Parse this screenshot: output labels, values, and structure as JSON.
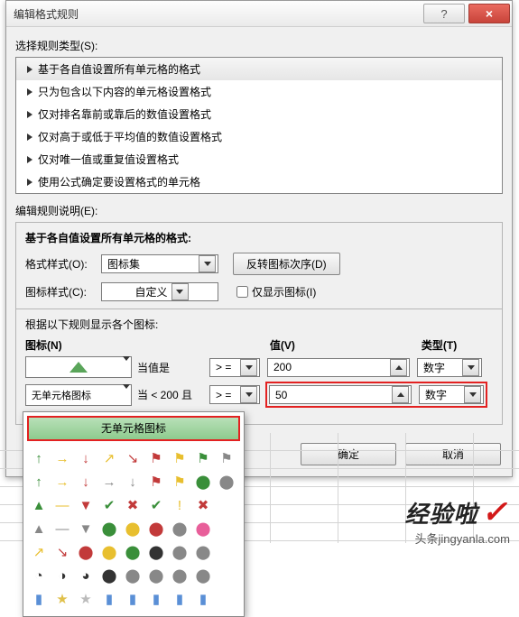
{
  "dialog": {
    "title": "编辑格式规则",
    "help_icon": "?",
    "close_icon": "×",
    "select_rule_type_label": "选择规则类型(S):",
    "rule_types": [
      "基于各自值设置所有单元格的格式",
      "只为包含以下内容的单元格设置格式",
      "仅对排名靠前或靠后的数值设置格式",
      "仅对高于或低于平均值的数值设置格式",
      "仅对唯一值或重复值设置格式",
      "使用公式确定要设置格式的单元格"
    ],
    "edit_rule_desc_label": "编辑规则说明(E):",
    "group_title": "基于各自值设置所有单元格的格式:",
    "format_style_label": "格式样式(O):",
    "format_style_value": "图标集",
    "reverse_btn": "反转图标次序(D)",
    "icon_style_label": "图标样式(C):",
    "icon_style_value": "自定义",
    "show_only_icon_label": "仅显示图标(I)",
    "display_rule_label": "根据以下规则显示各个图标:",
    "headers": {
      "icon": "图标(N)",
      "value": "值(V)",
      "type": "类型(T)"
    },
    "row1": {
      "cond": "当值是",
      "op": "> =",
      "value": "200",
      "type": "数字"
    },
    "row2": {
      "icon_text": "无单元格图标",
      "cond": "当 < 200 且",
      "op": "> =",
      "value": "50",
      "type": "数字"
    },
    "palette_header": "无单元格图标",
    "ok": "确定",
    "cancel": "取消"
  },
  "palette_icons": [
    "↑",
    "→",
    "↓",
    "↗",
    "↘",
    "⚑",
    "⚑",
    "⚑",
    "⚑",
    "↑",
    "→",
    "↓",
    "→",
    "↓",
    "⚑",
    "⚑",
    "⬤",
    "⬤",
    "▲",
    "—",
    "▼",
    "✔",
    "✖",
    "✔",
    "!",
    "✖",
    "",
    "▲",
    "—",
    "▼",
    "⬤",
    "⬤",
    "⬤",
    "⬤",
    "⬤",
    "",
    "↗",
    "↘",
    "⬤",
    "⬤",
    "⬤",
    "⬤",
    "⬤",
    "⬤",
    "",
    "◔",
    "◑",
    "◕",
    "⬤",
    "⬤",
    "⬤",
    "⬤",
    "⬤",
    "",
    "▮",
    "★",
    "★",
    "▮",
    "▮",
    "▮",
    "▮",
    "▮",
    ""
  ],
  "palette_colors": [
    "#3a8f3a",
    "#e8bf2f",
    "#c23a3a",
    "#e8bf2f",
    "#c23a3a",
    "#c23a3a",
    "#e8bf2f",
    "#3a8f3a",
    "#888",
    "#3a8f3a",
    "#e8bf2f",
    "#c23a3a",
    "#888",
    "#888",
    "#c23a3a",
    "#e8bf2f",
    "#3a8f3a",
    "#888",
    "#3a8f3a",
    "#e8bf2f",
    "#c23a3a",
    "#3a8f3a",
    "#c23a3a",
    "#3a8f3a",
    "#e8bf2f",
    "#c23a3a",
    "#888",
    "#888",
    "#888",
    "#888",
    "#3a8f3a",
    "#e8bf2f",
    "#c23a3a",
    "#888",
    "#e85f9a",
    "#888",
    "#e8bf2f",
    "#c23a3a",
    "#c23a3a",
    "#e8bf2f",
    "#3a8f3a",
    "#333",
    "#888",
    "#888",
    "#888",
    "#333",
    "#333",
    "#333",
    "#333",
    "#888",
    "#888",
    "#888",
    "#888",
    "#888",
    "#5a8fd6",
    "#e0c04a",
    "#bbb",
    "#5a8fd6",
    "#5a8fd6",
    "#5a8fd6",
    "#5a8fd6",
    "#5a8fd6",
    "#888"
  ],
  "watermark": {
    "brand": "经验啦",
    "sub": "头条jingyanla.com"
  }
}
